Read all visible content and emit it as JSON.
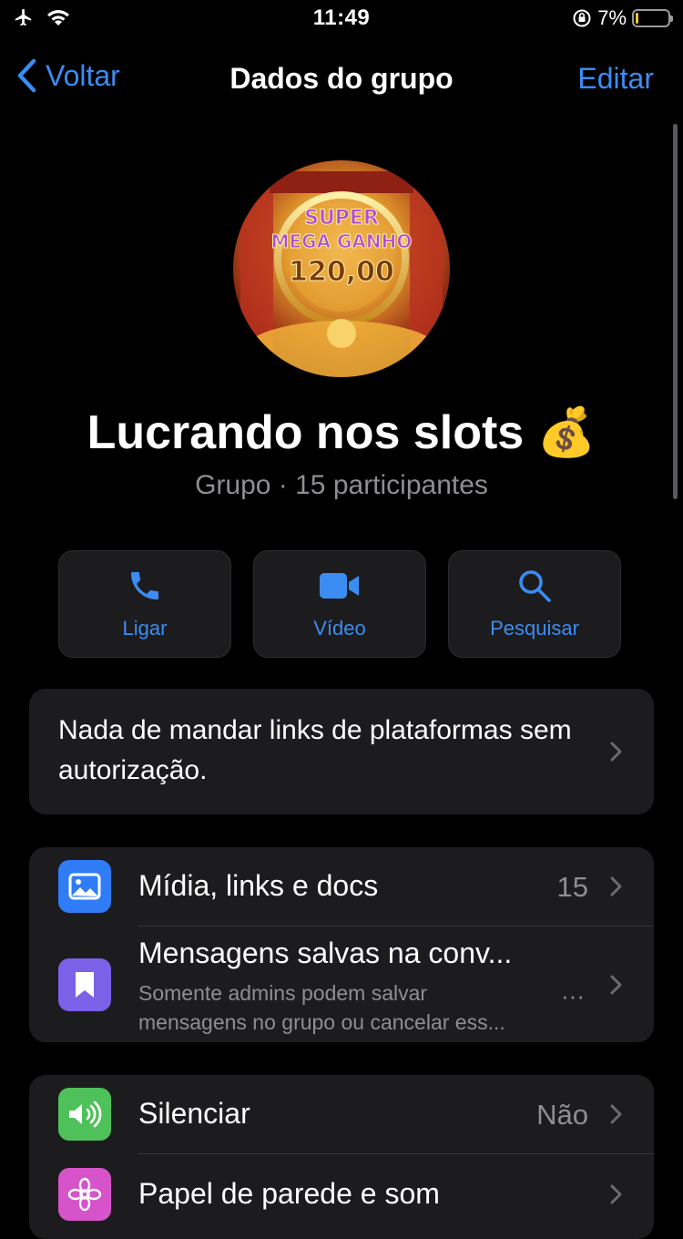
{
  "status_bar": {
    "time": "11:49",
    "battery_percent": "7%",
    "battery_level": 0.07,
    "icons": [
      "airplane-icon",
      "wifi-icon",
      "orientation-lock-icon",
      "battery-icon"
    ]
  },
  "nav": {
    "back_label": "Voltar",
    "title": "Dados do grupo",
    "edit_label": "Editar"
  },
  "group": {
    "name": "Lucrando nos slots",
    "emoji": "💰",
    "subtitle": "Grupo · 15 participantes",
    "avatar_text_line1": "SUPER",
    "avatar_text_line2": "MEGA GANHO",
    "avatar_text_line3": "120,00"
  },
  "actions": [
    {
      "label": "Ligar",
      "icon": "phone-icon"
    },
    {
      "label": "Vídeo",
      "icon": "video-icon"
    },
    {
      "label": "Pesquisar",
      "icon": "search-icon"
    }
  ],
  "description": "Nada de mandar links de plataformas sem autorização.",
  "media_section": {
    "media": {
      "title": "Mídia, links e docs",
      "count": "15"
    },
    "saved": {
      "title": "Mensagens salvas na conv...",
      "subtitle_line1": "Somente admins podem salvar",
      "subtitle_line2": "mensagens no grupo ou cancelar ess...",
      "more": "···"
    }
  },
  "settings_section": {
    "mute": {
      "title": "Silenciar",
      "value": "Não"
    },
    "wallpaper": {
      "title": "Papel de parede e som"
    }
  },
  "colors": {
    "accent": "#3b8cf3",
    "card_bg": "#1c1c1e",
    "media_tile": "#2f7cf6",
    "saved_tile": "#7b61e8",
    "mute_tile": "#4fc15a",
    "wallpaper_tile": "#d653c9"
  }
}
